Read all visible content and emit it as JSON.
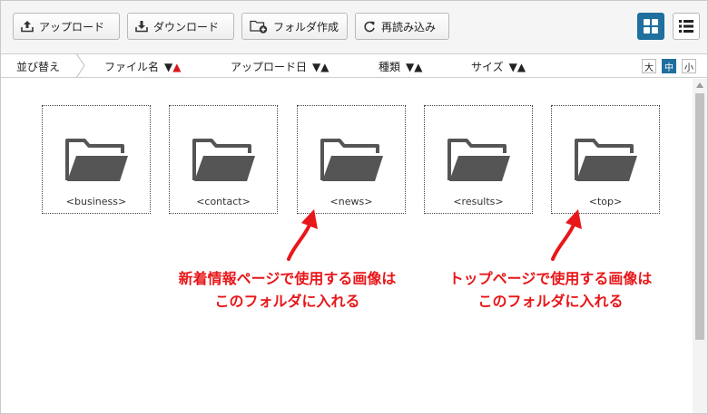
{
  "toolbar": {
    "upload_label": "アップロード",
    "download_label": "ダウンロード",
    "new_folder_label": "フォルダ作成",
    "reload_label": "再読み込み"
  },
  "sortbar": {
    "sort_label": "並び替え",
    "columns": [
      {
        "label": "ファイル名",
        "down": "▼",
        "up": "▲"
      },
      {
        "label": "アップロード日",
        "down": "▼",
        "up": "▲"
      },
      {
        "label": "種類",
        "down": "▼",
        "up": "▲"
      },
      {
        "label": "サイズ",
        "down": "▼",
        "up": "▲"
      }
    ],
    "sizes": [
      "大",
      "中",
      "小"
    ],
    "active_size": "中"
  },
  "folders": [
    {
      "name": "<business>"
    },
    {
      "name": "<contact>"
    },
    {
      "name": "<news>"
    },
    {
      "name": "<results>"
    },
    {
      "name": "<top>"
    }
  ],
  "annotations": [
    {
      "line1": "新着情報ページで使用する画像は",
      "line2": "このフォルダに入れる"
    },
    {
      "line1": "トップページで使用する画像は",
      "line2": "このフォルダに入れる"
    }
  ],
  "colors": {
    "accent": "#1f6f9f",
    "annotation": "#e8171a",
    "folder_icon": "#555555",
    "sort_active_arrow": "#d9161c"
  }
}
